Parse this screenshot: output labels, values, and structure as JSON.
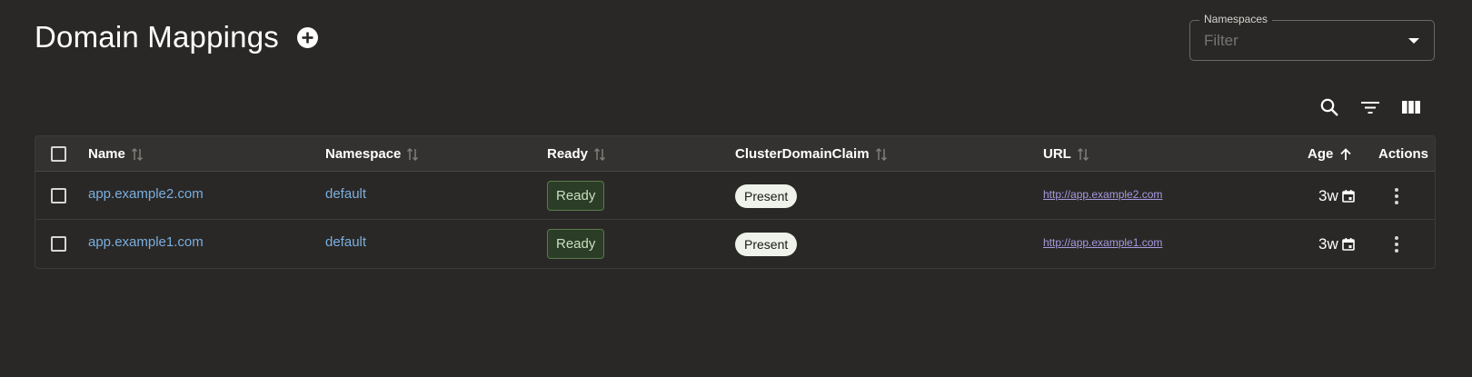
{
  "header": {
    "title": "Domain Mappings",
    "add_icon": "plus-circle-icon"
  },
  "namespace_filter": {
    "label": "Namespaces",
    "placeholder": "Filter",
    "caret_icon": "caret-down-icon"
  },
  "toolbar": {
    "icons": [
      "search-icon",
      "filter-lines-icon",
      "columns-icon"
    ]
  },
  "table": {
    "columns": [
      {
        "label": "Name",
        "sort_icon": "sort-neutral-icon"
      },
      {
        "label": "Namespace",
        "sort_icon": "sort-neutral-icon"
      },
      {
        "label": "Ready",
        "sort_icon": "sort-neutral-icon"
      },
      {
        "label": "ClusterDomainClaim",
        "sort_icon": "sort-neutral-icon"
      },
      {
        "label": "URL",
        "sort_icon": "sort-neutral-icon"
      },
      {
        "label": "Age",
        "sort_icon": "sort-ascending-icon"
      },
      {
        "label": "Actions"
      }
    ],
    "rows": [
      {
        "name": "app.example2.com",
        "namespace": "default",
        "ready": "Ready",
        "claim": "Present",
        "url": "http://app.example2.com",
        "age": "3w"
      },
      {
        "name": "app.example1.com",
        "namespace": "default",
        "ready": "Ready",
        "claim": "Present",
        "url": "http://app.example1.com",
        "age": "3w"
      }
    ]
  },
  "colors": {
    "background": "#2a2826",
    "link": "#79aee0",
    "url_link": "#a79ae0",
    "ready_badge_bg": "#2b3d27",
    "chip_bg": "#eef2ea"
  }
}
